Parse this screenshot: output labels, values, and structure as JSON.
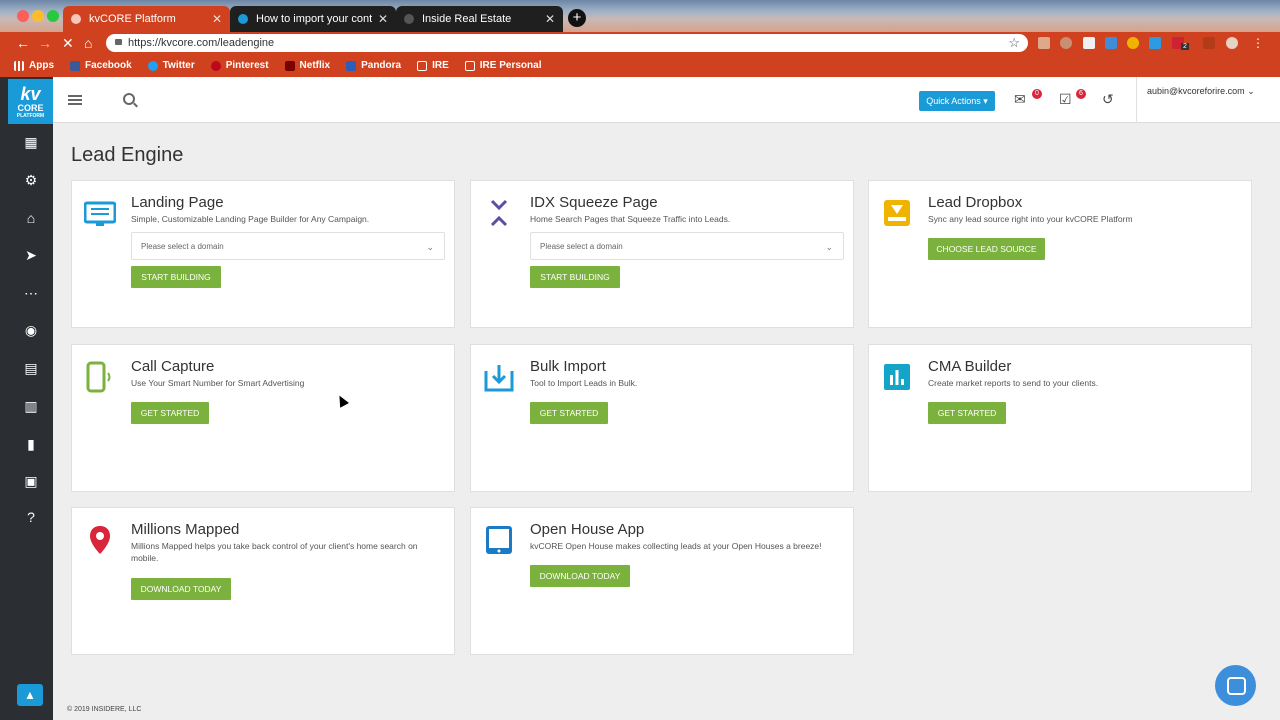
{
  "browser": {
    "tabs": [
      {
        "title": "kvCORE Platform",
        "active": true
      },
      {
        "title": "How to import your contacts to",
        "active": false
      },
      {
        "title": "Inside Real Estate",
        "active": false
      }
    ],
    "new_tab_label": "+",
    "url": "https://kvcore.com/leadengine",
    "bookmarks": [
      "Apps",
      "Facebook",
      "Twitter",
      "Pinterest",
      "Netflix",
      "Pandora",
      "IRE",
      "IRE Personal"
    ],
    "extension_badge": "2"
  },
  "app": {
    "logo": {
      "line1": "kv",
      "line2": "CORE",
      "line3": "PLATFORM"
    },
    "quick_actions_label": "Quick Actions",
    "mail_badge": "0",
    "tasks_badge": "6",
    "user_email": "aubin@kvcoreforire.com",
    "page_title": "Lead Engine",
    "footer": "© 2019 INSIDERE, LLC"
  },
  "cards": [
    {
      "title": "Landing Page",
      "desc": "Simple, Customizable Landing Page Builder for Any Campaign.",
      "select_placeholder": "Please select a domain",
      "button": "START BUILDING"
    },
    {
      "title": "IDX Squeeze Page",
      "desc": "Home Search Pages that Squeeze Traffic into Leads.",
      "select_placeholder": "Please select a domain",
      "button": "START BUILDING"
    },
    {
      "title": "Lead Dropbox",
      "desc": "Sync any lead source right into your kvCORE Platform",
      "button": "CHOOSE LEAD SOURCE"
    },
    {
      "title": "Call Capture",
      "desc": "Use Your Smart Number for Smart Advertising",
      "button": "GET STARTED"
    },
    {
      "title": "Bulk Import",
      "desc": "Tool to Import Leads in Bulk.",
      "button": "GET STARTED"
    },
    {
      "title": "CMA Builder",
      "desc": "Create market reports to send to your clients.",
      "button": "GET STARTED"
    },
    {
      "title": "Millions Mapped",
      "desc": "Millions Mapped helps you take back control of your client's home search on mobile.",
      "button": "DOWNLOAD TODAY"
    },
    {
      "title": "Open House App",
      "desc": "kvCORE Open House makes collecting leads at your Open Houses a breeze!",
      "button": "DOWNLOAD TODAY"
    }
  ],
  "colors": {
    "browser_accent": "#d0421f",
    "brand_blue": "#1a9ad6",
    "button_green": "#7bb13d",
    "sidebar": "#2b2e33"
  }
}
